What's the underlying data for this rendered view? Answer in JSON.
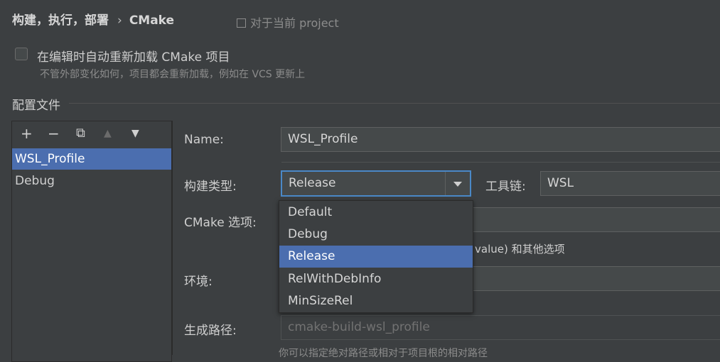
{
  "header": {
    "breadcrumb_parent": "构建，执行，部署",
    "breadcrumb_separator": "›",
    "breadcrumb_current": "CMake",
    "scope_label": "对于当前 project"
  },
  "reload": {
    "checked": false,
    "label": "在编辑时自动重新加载 CMake 项目",
    "hint": "不管外部变化如何，项目都会重新加载，例如在 VCS 更新上"
  },
  "profiles": {
    "section_title": "配置文件",
    "toolbar": {
      "add": "+",
      "remove": "−",
      "copy": "⧉",
      "up": "▲",
      "down": "▼"
    },
    "items": [
      {
        "label": "WSL_Profile",
        "selected": true
      },
      {
        "label": "Debug",
        "selected": false
      }
    ]
  },
  "form": {
    "name_label": "Name:",
    "name_value": "WSL_Profile",
    "build_type_label": "构建类型:",
    "build_type_value": "Release",
    "toolchain_label": "工具链:",
    "toolchain_value": "WSL",
    "cmake_options_label": "CMake 选项:",
    "cmake_options_hint": "value) 和其他选项",
    "env_label": "环境:",
    "gen_path_label": "生成路径:",
    "gen_path_placeholder": "cmake-build-wsl_profile",
    "gen_path_hint": "你可以指定绝对路径或相对于项目根的相对路径"
  },
  "build_type_dropdown": {
    "options": [
      "Default",
      "Debug",
      "Release",
      "RelWithDebInfo",
      "MinSizeRel"
    ],
    "selected": "Release"
  },
  "colors": {
    "background": "#3c3f41",
    "selection": "#4b6eaf",
    "focus_border": "#4a88c7",
    "field_bg": "#45494a"
  }
}
